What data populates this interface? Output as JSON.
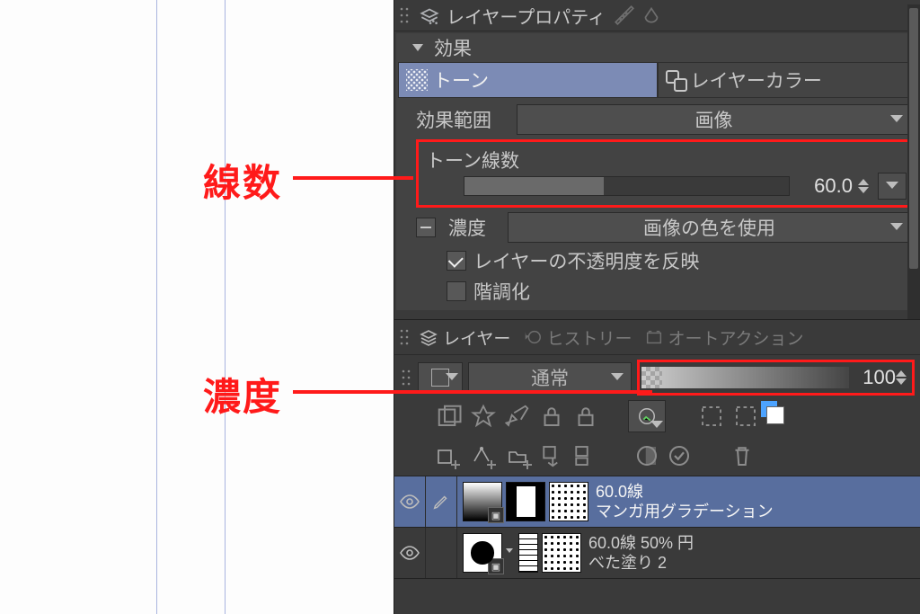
{
  "tabs": {
    "layerProperty": "レイヤープロパティ"
  },
  "effects": {
    "heading": "効果",
    "tone_label": "トーン",
    "layerColor_label": "レイヤーカラー"
  },
  "scope": {
    "label": "効果範囲",
    "value": "画像"
  },
  "frequency": {
    "label": "トーン線数",
    "value": "60.0"
  },
  "density": {
    "label": "濃度",
    "value": "画像の色を使用"
  },
  "checks": {
    "reflect_opacity": "レイヤーの不透明度を反映",
    "posterize": "階調化"
  },
  "layerTabs": {
    "layer": "レイヤー",
    "history": "ヒストリー",
    "autoAction": "オートアクション"
  },
  "blend": {
    "mode": "通常"
  },
  "opacity": {
    "value": "100"
  },
  "layers": {
    "a_line1": "60.0線",
    "a_line2": "マンガ用グラデーション",
    "b_line1": "60.0線 50% 円",
    "b_line2": "べた塗り 2"
  },
  "annotations": {
    "lines": "線数",
    "density": "濃度"
  }
}
